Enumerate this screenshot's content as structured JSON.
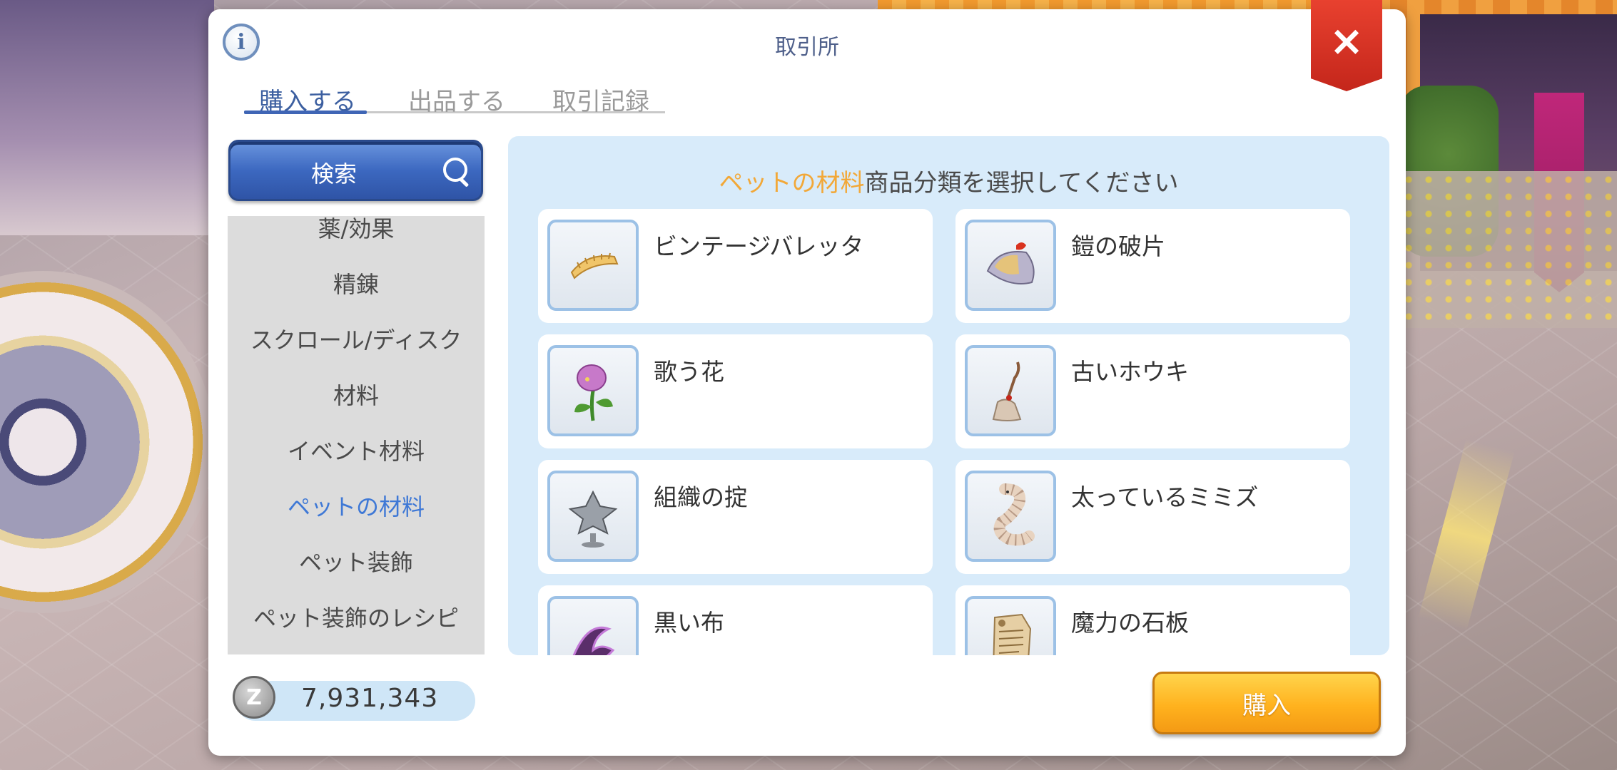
{
  "window": {
    "title": "取引所",
    "info_icon": "info-icon",
    "close_icon": "close-icon",
    "close_glyph": "×"
  },
  "tabs": [
    {
      "label": "購入する",
      "active": true
    },
    {
      "label": "出品する",
      "active": false
    },
    {
      "label": "取引記録",
      "active": false
    }
  ],
  "search": {
    "label": "検索",
    "icon": "search-icon"
  },
  "categories": [
    {
      "label": "薬/効果",
      "selected": false
    },
    {
      "label": "精錬",
      "selected": false
    },
    {
      "label": "スクロール/ディスク",
      "selected": false
    },
    {
      "label": "材料",
      "selected": false
    },
    {
      "label": "イベント材料",
      "selected": false
    },
    {
      "label": "ペットの材料",
      "selected": true
    },
    {
      "label": "ペット装飾",
      "selected": false
    },
    {
      "label": "ペット装飾のレシピ",
      "selected": false
    }
  ],
  "prompt": {
    "highlight": "ペットの材料",
    "text": "商品分類を選択してください"
  },
  "items": [
    {
      "name": "ビンテージバレッタ",
      "icon": "barrette-icon"
    },
    {
      "name": "鎧の破片",
      "icon": "armor-fragment-icon"
    },
    {
      "name": "歌う花",
      "icon": "singing-flower-icon"
    },
    {
      "name": "古いホウキ",
      "icon": "old-broom-icon"
    },
    {
      "name": "組織の掟",
      "icon": "organization-rule-icon"
    },
    {
      "name": "太っているミミズ",
      "icon": "fat-worm-icon"
    },
    {
      "name": "黒い布",
      "icon": "black-cloth-icon"
    },
    {
      "name": "魔力の石板",
      "icon": "magic-tablet-icon"
    }
  ],
  "zeny": {
    "amount": "7,931,343",
    "icon_glyph": "Z"
  },
  "buy_button": {
    "label": "購入"
  },
  "colors": {
    "accent_blue": "#3f65b5",
    "highlight_orange": "#f2a838",
    "close_red": "#d9321f",
    "buy_orange": "#ffb21e"
  }
}
